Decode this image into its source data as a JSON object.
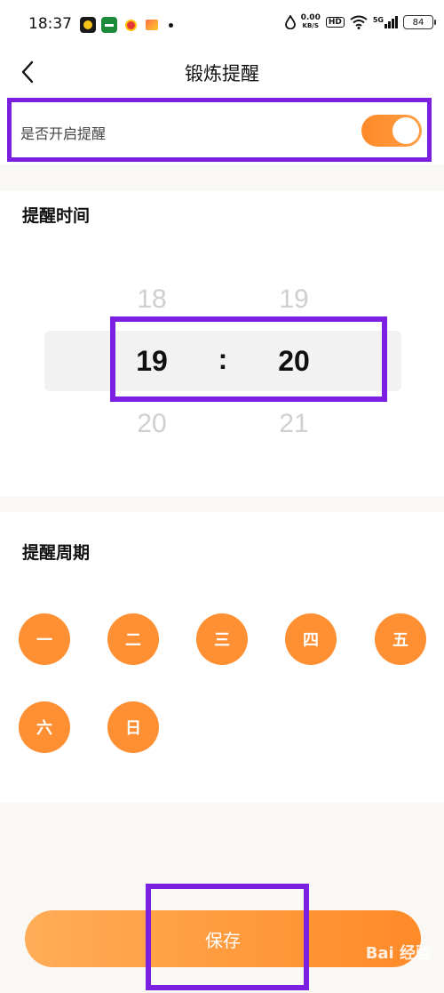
{
  "status_bar": {
    "time": "18:37",
    "net_speed": "0.00",
    "net_unit": "KB/S",
    "hd": "HD",
    "signal": "5G",
    "battery": "84"
  },
  "nav": {
    "title": "锻炼提醒"
  },
  "reminder_toggle": {
    "label": "是否开启提醒",
    "enabled": true
  },
  "time_section": {
    "title": "提醒时间",
    "hour": {
      "prev": "18",
      "selected": "19",
      "next": "20"
    },
    "separator": ":",
    "minute": {
      "prev": "19",
      "selected": "20",
      "next": "21"
    }
  },
  "cycle_section": {
    "title": "提醒周期",
    "days": [
      "一",
      "二",
      "三",
      "四",
      "五",
      "六",
      "日"
    ]
  },
  "save_button": {
    "label": "保存"
  },
  "watermark": "Bai 经验",
  "colors": {
    "accent": "#ff8f33",
    "highlight": "#7b1fe0"
  }
}
